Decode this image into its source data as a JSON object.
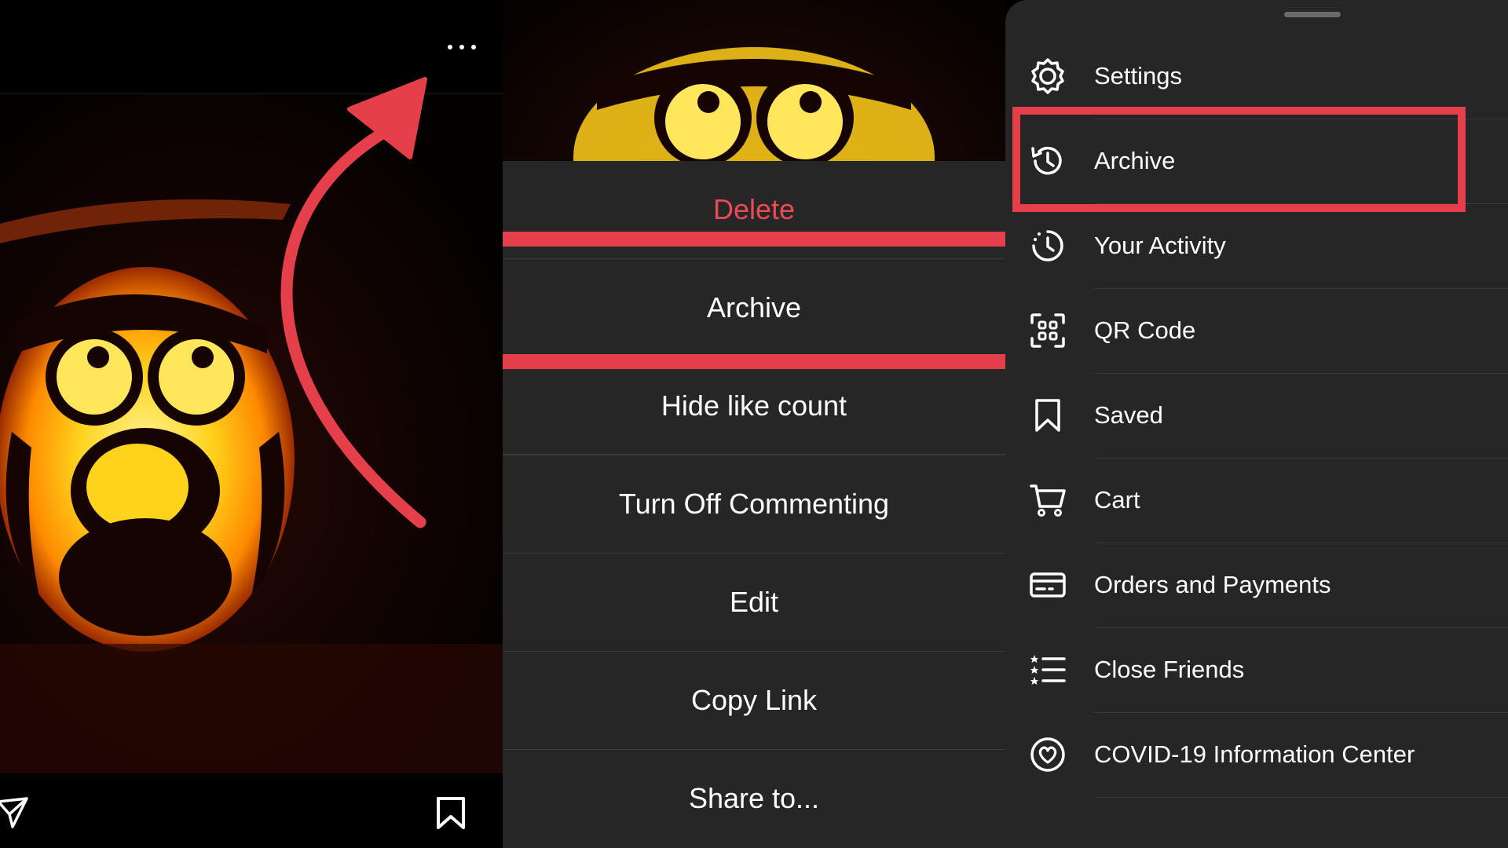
{
  "post_actions": {
    "delete_label": "Delete",
    "archive_label": "Archive",
    "hide_like_count_label": "Hide like count",
    "turn_off_commenting_label": "Turn Off Commenting",
    "edit_label": "Edit",
    "copy_link_label": "Copy Link",
    "share_to_label": "Share to..."
  },
  "menu": {
    "items": [
      {
        "label": "Settings",
        "icon": "settings-icon"
      },
      {
        "label": "Archive",
        "icon": "archive-history-icon"
      },
      {
        "label": "Your Activity",
        "icon": "activity-icon"
      },
      {
        "label": "QR Code",
        "icon": "qr-code-icon"
      },
      {
        "label": "Saved",
        "icon": "bookmark-icon"
      },
      {
        "label": "Cart",
        "icon": "cart-icon"
      },
      {
        "label": "Orders and Payments",
        "icon": "card-icon"
      },
      {
        "label": "Close Friends",
        "icon": "close-friends-list-icon"
      },
      {
        "label": "COVID-19 Information Center",
        "icon": "covid-info-icon"
      }
    ]
  },
  "colors": {
    "highlight_red": "#e5404a",
    "danger_text": "#ed4956",
    "sheet_bg": "#262626"
  }
}
